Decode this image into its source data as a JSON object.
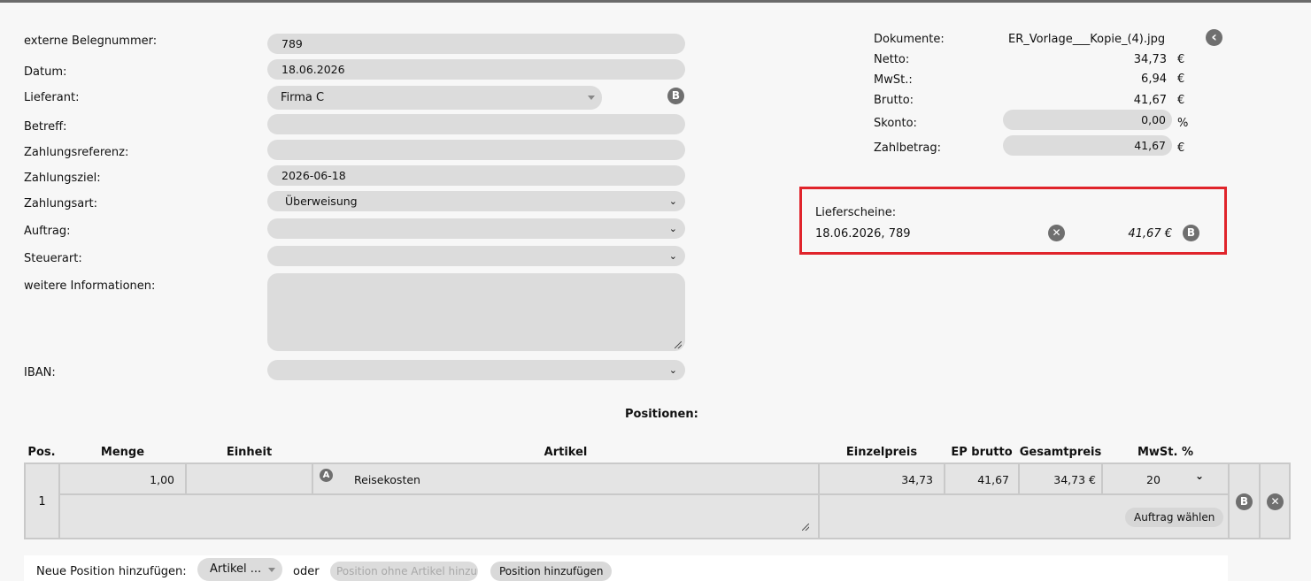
{
  "form": {
    "labels": {
      "belegnummer": "externe Belegnummer:",
      "datum": "Datum:",
      "lieferant": "Lieferant:",
      "betreff": "Betreff:",
      "zahlungsreferenz": "Zahlungsreferenz:",
      "zahlungsziel": "Zahlungsziel:",
      "zahlungsart": "Zahlungsart:",
      "auftrag": "Auftrag:",
      "steuerart": "Steuerart:",
      "weitere": "weitere Informationen:",
      "iban": "IBAN:"
    },
    "values": {
      "belegnummer": "789",
      "datum": "18.06.2026",
      "lieferant": "Firma C",
      "betreff": "",
      "zahlungsreferenz": "",
      "zahlungsziel": "2026-06-18",
      "zahlungsart": "Überweisung",
      "auftrag": "",
      "steuerart": "",
      "weitere": "",
      "iban": ""
    },
    "lieferant_badge": "B"
  },
  "summary": {
    "dokumente_label": "Dokumente:",
    "dokumente_value": "ER_Vorlage___Kopie_(4).jpg",
    "netto_label": "Netto:",
    "netto_value": "34,73",
    "mwst_label": "MwSt.:",
    "mwst_value": "6,94",
    "brutto_label": "Brutto:",
    "brutto_value": "41,67",
    "skonto_label": "Skonto:",
    "skonto_value": "0,00",
    "zahlbetrag_label": "Zahlbetrag:",
    "zahlbetrag_value": "41,67",
    "currency": "€",
    "percent": "%",
    "back_icon": "‹"
  },
  "lieferscheine": {
    "title": "Lieferscheine:",
    "entry": "18.06.2026, 789",
    "amount": "41,67 €",
    "remove_icon": "✕",
    "badge": "B"
  },
  "positions": {
    "title": "Positionen:",
    "headers": {
      "pos": "Pos.",
      "menge": "Menge",
      "einheit": "Einheit",
      "artikel": "Artikel",
      "einzelpreis": "Einzelpreis",
      "ep_brutto": "EP brutto",
      "gesamtpreis": "Gesamtpreis",
      "mwst": "MwSt. %"
    },
    "row": {
      "pos": "1",
      "menge": "1,00",
      "einheit": "",
      "artikel_badge": "A",
      "artikel": "Reisekosten",
      "einzelpreis": "34,73",
      "ep_brutto": "41,67",
      "gesamtpreis": "34,73 €",
      "mwst": "20",
      "auftrag_button": "Auftrag wählen",
      "row_badge": "B",
      "remove_icon": "✕"
    }
  },
  "footer": {
    "label": "Neue Position hinzufügen:",
    "artikel_select": "Artikel ...",
    "oder": "oder",
    "placeholder": "Position ohne Artikel hinzu",
    "add_button": "Position hinzufügen"
  }
}
